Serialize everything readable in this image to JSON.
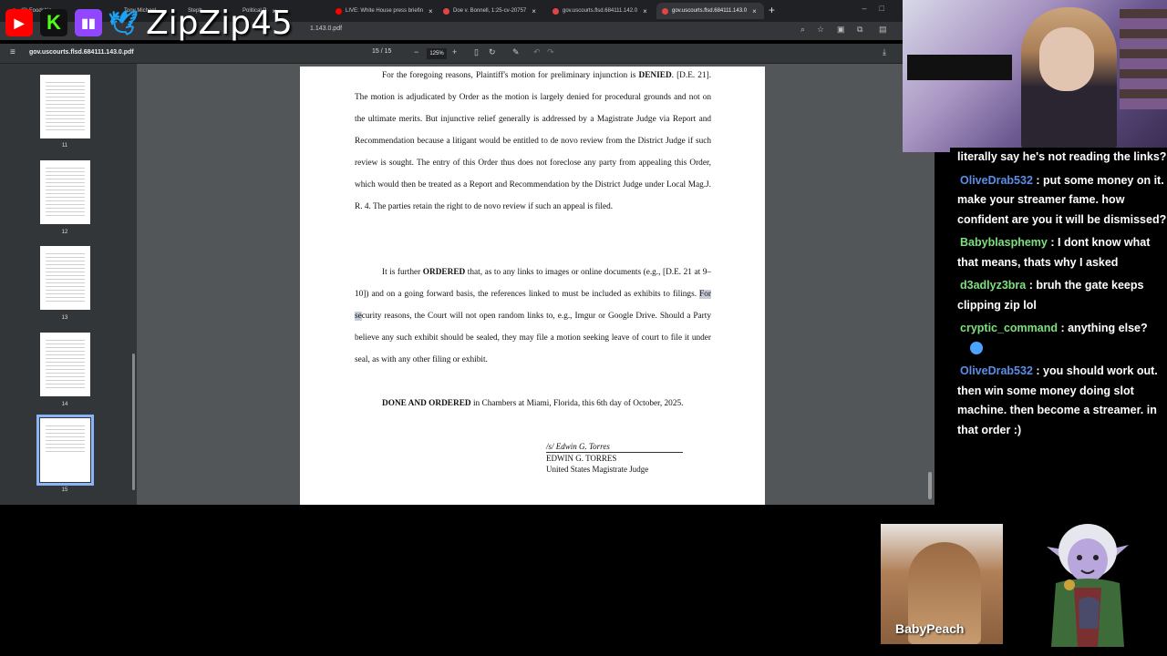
{
  "browser": {
    "tabs": [
      {
        "label": "(3) Foodship"
      },
      {
        "label": "Tony Michael"
      },
      {
        "label": "Steph"
      },
      {
        "label": "Political P"
      },
      {
        "label": "LIVE: White House press briefin"
      },
      {
        "label": "Doe v. Bonnell, 1:25-cv-20757"
      },
      {
        "label": "gov.uscourts.flsd.684111.142.0"
      },
      {
        "label": "gov.uscourts.flsd.684111.143.0"
      }
    ],
    "address": "1.143.0.pdf"
  },
  "pdf_toolbar": {
    "filename": "gov.uscourts.flsd.684111.143.0.pdf",
    "page_current": "15",
    "page_sep": "/",
    "page_total": "15",
    "zoom": "125%"
  },
  "thumbnails": [
    {
      "num": "11"
    },
    {
      "num": "12"
    },
    {
      "num": "13"
    },
    {
      "num": "14"
    },
    {
      "num": "15"
    }
  ],
  "document": {
    "p1_a": "For the foregoing reasons, Plaintiff's motion for preliminary injunction is",
    "p1_bold": "DENIED",
    "p1_b": ". [D.E. 21]. The motion is adjudicated by Order as the motion is largely denied for procedural grounds and not on the ultimate merits. But injunctive relief generally is addressed by a Magistrate Judge via Report and Recommendation because a litigant would be entitled to de novo review from the District Judge if such review is sought. The entry of this Order thus does not foreclose any party from appealing this Order, which would then be treated as a Report and Recommendation by the District Judge under Local Mag.J. R. 4. The parties retain the right to de novo review if such an appeal is filed.",
    "p2_a": "It is further",
    "p2_bold": "ORDERED",
    "p2_b": "that, as to any links to images or online documents (e.g., [D.E. 21 at 9–10]) and on a going forward basis, the references linked to must be included as exhibits to filings.",
    "p2_hl": "For se",
    "p2_c": "curity reasons, the Court will not open random links to, e.g., Imgur or Google Drive. Should a Party believe any such exhibit should be sealed, they may file a motion seeking leave of court to file it under seal, as with any other filing or exhibit.",
    "p3_bold": "DONE AND ORDERED",
    "p3_b": "in Chambers at Miami, Florida, this 6th day of October, 2025.",
    "sig_line": "/s/ Edwin G. Torres",
    "sig_name": "EDWIN G. TORRES",
    "sig_title": "United States Magistrate Judge"
  },
  "overlay": {
    "handle": "ZipZip45",
    "chat": [
      {
        "user": "",
        "text": "literally say he's not reading the links?",
        "color": "#ffffff"
      },
      {
        "user": "OliveDrab532",
        "text": ": put some money on it. make your streamer fame. how confident are you it will be dismissed?",
        "color": "#5b8ee6"
      },
      {
        "user": "Babyblasphemy",
        "text": ": I dont know what that means, thats why I asked",
        "color": "#7ee07e"
      },
      {
        "user": "d3adlyz3bra",
        "text": ": bruh the gate keeps clipping zip lol",
        "color": "#7ee07e"
      },
      {
        "user": "cryptic_command",
        "text": ": anything else?",
        "color": "#7ee07e"
      },
      {
        "user": "OliveDrab532",
        "text": ": you should work out. then win some money doing slot machine. then become a streamer. in that order :)",
        "color": "#5b8ee6"
      }
    ],
    "cam2_label": "BabyPeach"
  },
  "colors": {
    "youtube": "#ff0000",
    "kick": "#53fc18",
    "twitch": "#9146ff",
    "twitter": "#1da1f2"
  }
}
